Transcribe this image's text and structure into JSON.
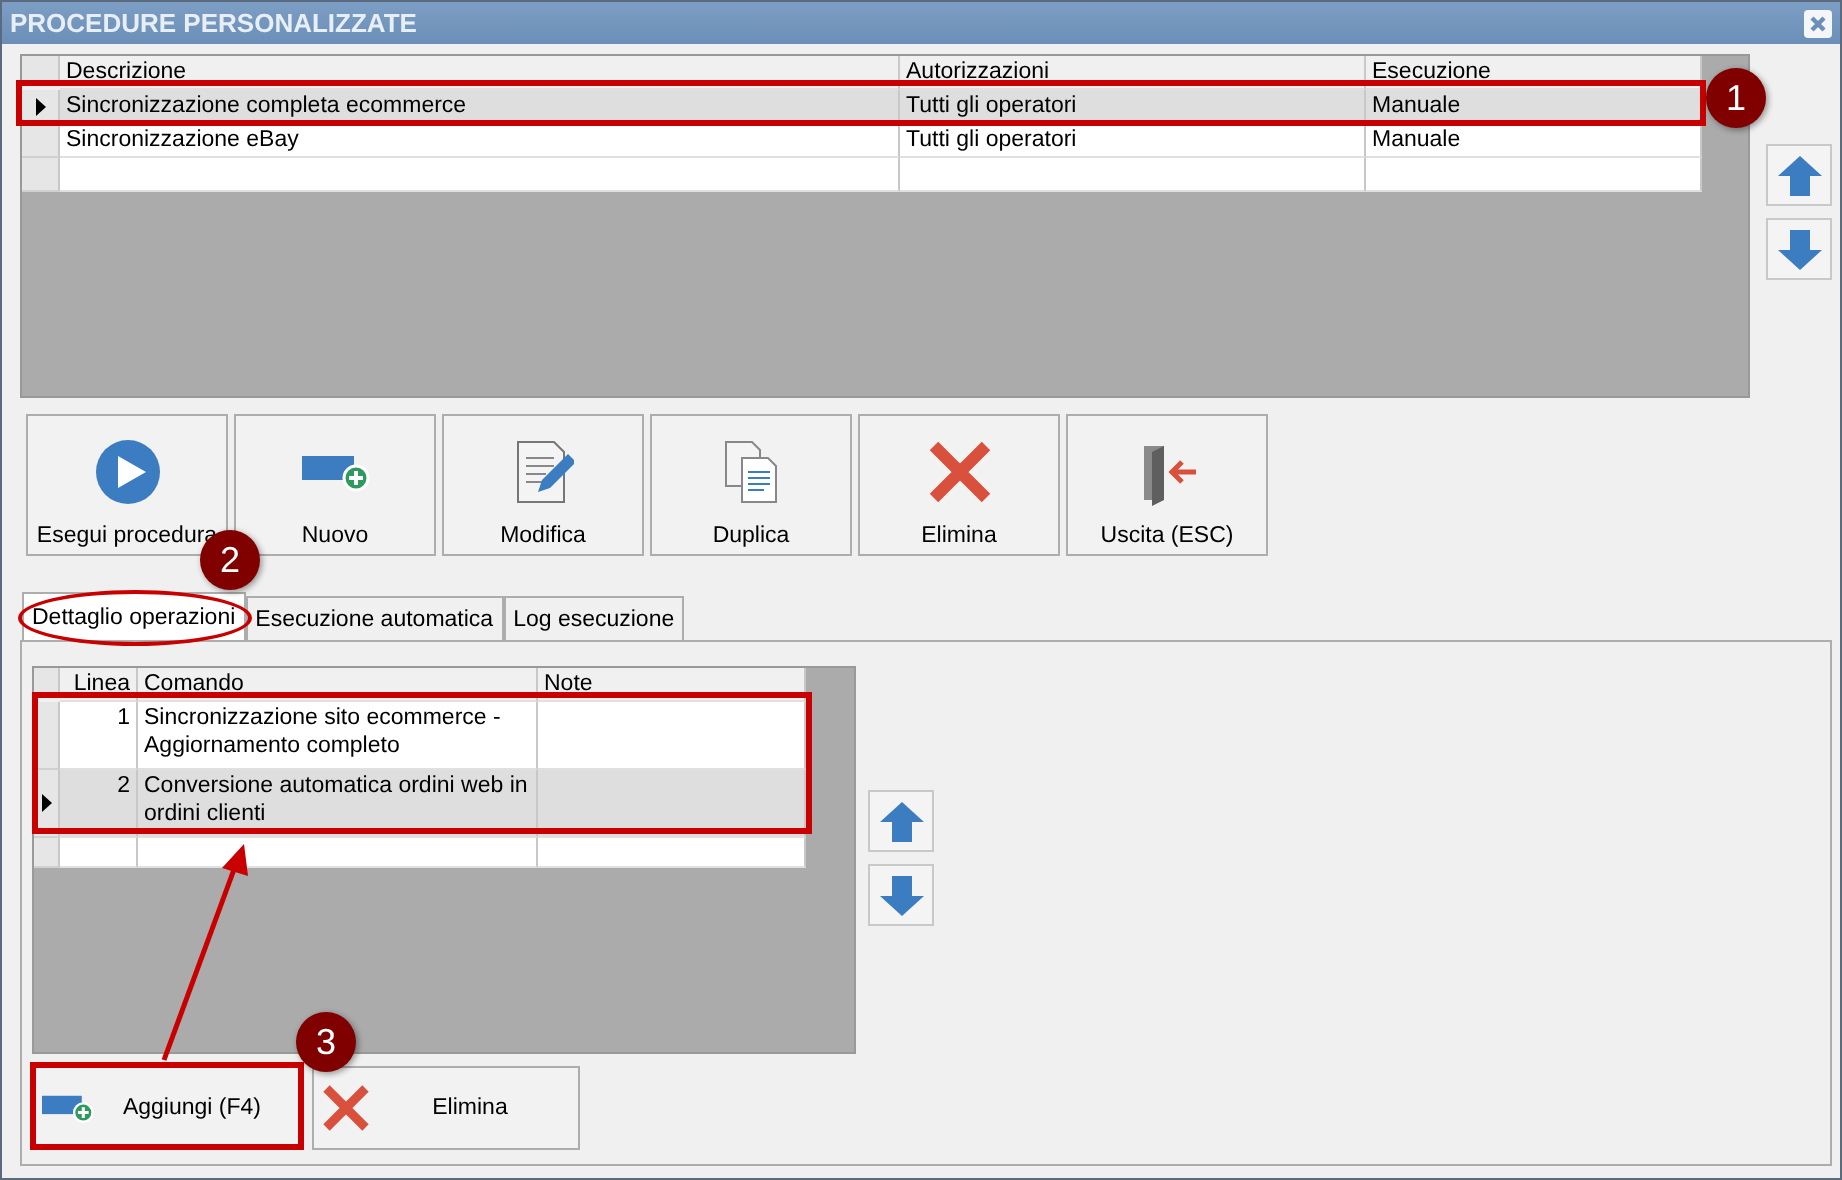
{
  "window": {
    "title": "PROCEDURE PERSONALIZZATE"
  },
  "procedures": {
    "columns": [
      "Descrizione",
      "Autorizzazioni",
      "Esecuzione"
    ],
    "rows": [
      {
        "description": "Sincronizzazione completa ecommerce",
        "authorization": "Tutti gli operatori",
        "execution": "Manuale",
        "selected": true
      },
      {
        "description": "Sincronizzazione eBay",
        "authorization": "Tutti gli operatori",
        "execution": "Manuale",
        "selected": false
      }
    ]
  },
  "toolbar": [
    {
      "label": "Esegui procedura",
      "kind": "run"
    },
    {
      "label": "Nuovo",
      "kind": "new"
    },
    {
      "label": "Modifica",
      "kind": "edit"
    },
    {
      "label": "Duplica",
      "kind": "duplicate"
    },
    {
      "label": "Elimina",
      "kind": "delete"
    },
    {
      "label": "Uscita (ESC)",
      "kind": "exit"
    }
  ],
  "tabs": [
    {
      "label": "Dettaglio operazioni",
      "selected": true
    },
    {
      "label": "Esecuzione automatica",
      "selected": false
    },
    {
      "label": "Log esecuzione",
      "selected": false
    }
  ],
  "operations": {
    "columns": [
      "Linea",
      "Comando",
      "Note"
    ],
    "rows": [
      {
        "line": "1",
        "command": "Sincronizzazione sito ecommerce - Aggiornamento completo",
        "selected": false
      },
      {
        "line": "2",
        "command": "Conversione automatica ordini web in ordini clienti",
        "selected": true
      }
    ]
  },
  "bottom_buttons": [
    {
      "label": "Aggiungi (F4)",
      "kind": "new"
    },
    {
      "label": "Elimina",
      "kind": "delete"
    }
  ],
  "callouts": [
    {
      "number": "1"
    },
    {
      "number": "2"
    },
    {
      "number": "3"
    }
  ]
}
